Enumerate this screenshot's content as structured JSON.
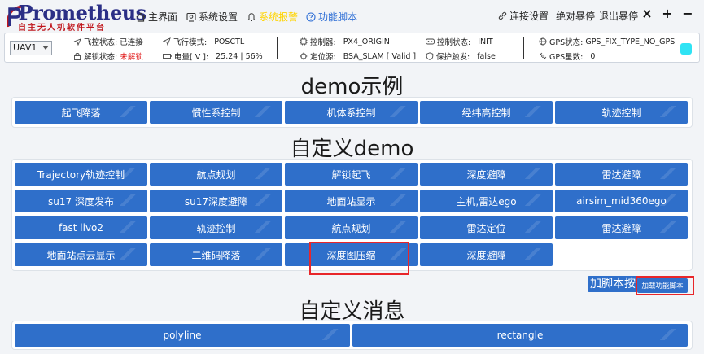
{
  "app": {
    "logo_text": "Prometheus",
    "logo_sub": "自主无人机软件平台"
  },
  "nav": {
    "home": "主界面",
    "settings": "系统设置",
    "alerts": "系统报警",
    "scripts": "功能脚本"
  },
  "window": {
    "connect": "连接设置",
    "abs_stop": "绝对暴停",
    "exit_stop": "退出暴停",
    "btn_close": "×",
    "btn_add": "+",
    "btn_min": "−"
  },
  "status": {
    "uav_select": "UAV1",
    "fc_label": "飞控状态:",
    "fc_value": "已连接",
    "lock_label": "解锁状态:",
    "lock_value": "未解锁",
    "flight_mode_label": "飞行模式:",
    "flight_mode_value": "POSCTL",
    "battery_label": "电量[ V ]:",
    "battery_value": "25.24 | 56%",
    "controller_label": "控制器:",
    "controller_value": "PX4_ORIGIN",
    "locsrc_label": "定位源:",
    "locsrc_value": "BSA_SLAM [ Valid ]",
    "ctrl_state_label": "控制状态:",
    "ctrl_state_value": "INIT",
    "protect_label": "保护触发:",
    "protect_value": "false",
    "gps_state_label": "GPS状态:",
    "gps_state_value": "GPS_FIX_TYPE_NO_GPS",
    "gps_count_label": "GPS星数:",
    "gps_count_value": "0",
    "indicator_color": "#2fe3f4"
  },
  "sections": {
    "demo_title": "demo示例",
    "custom_title": "自定义demo",
    "msg_title": "自定义消息"
  },
  "demo_buttons": [
    "起飞降落",
    "惯性系控制",
    "机体系控制",
    "经纬高控制",
    "轨迹控制"
  ],
  "custom_buttons": [
    "Trajectory轨迹控制",
    "航点规划",
    "解锁起飞",
    "深度避障",
    "雷达避障",
    "su17 深度发布",
    "su17深度避障",
    "地面站显示",
    "主机,雷达ego",
    "airsim_mid360ego",
    "fast livo2",
    "轨迹控制",
    "航点规划",
    "雷达定位",
    "雷达避障",
    "地面站点云显示",
    "二维码降落",
    "深度图压缩",
    "深度避障"
  ],
  "script_area": {
    "label": "加脚本按",
    "load_button": "加载功能脚本"
  },
  "msg_buttons": [
    "polyline",
    "rectangle"
  ],
  "colors": {
    "button_blue": "#2f6fca",
    "highlight_red": "#e8262a",
    "brand_navy": "#2b2f86",
    "brand_red": "#c0161c"
  }
}
